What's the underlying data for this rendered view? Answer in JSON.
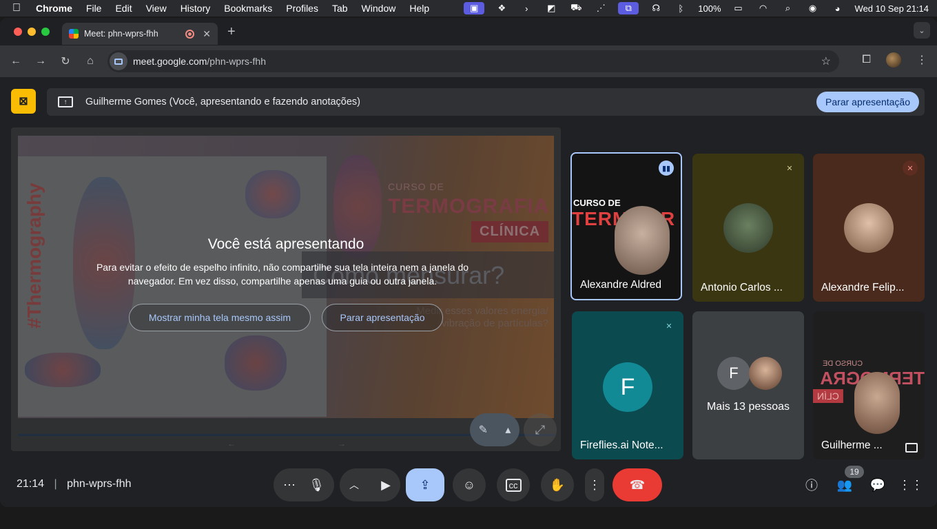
{
  "menubar": {
    "app": "Chrome",
    "items": [
      "File",
      "Edit",
      "View",
      "History",
      "Bookmarks",
      "Profiles",
      "Tab",
      "Window",
      "Help"
    ],
    "battery": "100%",
    "datetime": "Wed 10 Sep  21:14"
  },
  "browser": {
    "tab_title": "Meet: phn-wprs-fhh",
    "url_host": "meet.google.com",
    "url_path": "/phn-wprs-fhh"
  },
  "banner": {
    "text": "Guilherme Gomes (Você, apresentando e fazendo anotações)",
    "stop_label": "Parar apresentação"
  },
  "stage": {
    "slide": {
      "vertical_text": "#Thermography",
      "course": "CURSO DE",
      "title": "TERMOGRAFIA",
      "badge": "CLÍNICA",
      "question": "Como mensurar?",
      "subtitle_1": "Medir esses valores energia/",
      "subtitle_2": "vibração de partículas?"
    },
    "overlay_title": "Você está apresentando",
    "overlay_desc": "Para evitar o efeito de espelho infinito, não compartilhe sua tela inteira nem a janela do navegador. Em vez disso, compartilhe apenas uma guia ou outra janela.",
    "show_anyway_label": "Mostrar minha tela mesmo assim",
    "stop_label": "Parar apresentação"
  },
  "tiles": {
    "t1": "Alexandre Aldred",
    "t2": "Antonio Carlos ...",
    "t3": "Alexandre Felip...",
    "t4": "Fireflies.ai Note...",
    "t4_initial": "F",
    "t5": "Mais 13 pessoas",
    "t5_initial": "F",
    "t6": "Guilherme ...",
    "t1_overlay_1": "CURSO DE",
    "t1_overlay_2": "TERMOGR",
    "t6_overlay_1": "CURSO DE",
    "t6_overlay_2": "TERMOGRA",
    "t6_overlay_3": "CLÍN"
  },
  "bottom": {
    "time": "21:14",
    "meeting_code": "phn-wprs-fhh",
    "participants_count": "19"
  },
  "colors": {
    "accent": "#a8c7fa",
    "end_call": "#ea3a34",
    "presenting": "#fbbc04"
  }
}
